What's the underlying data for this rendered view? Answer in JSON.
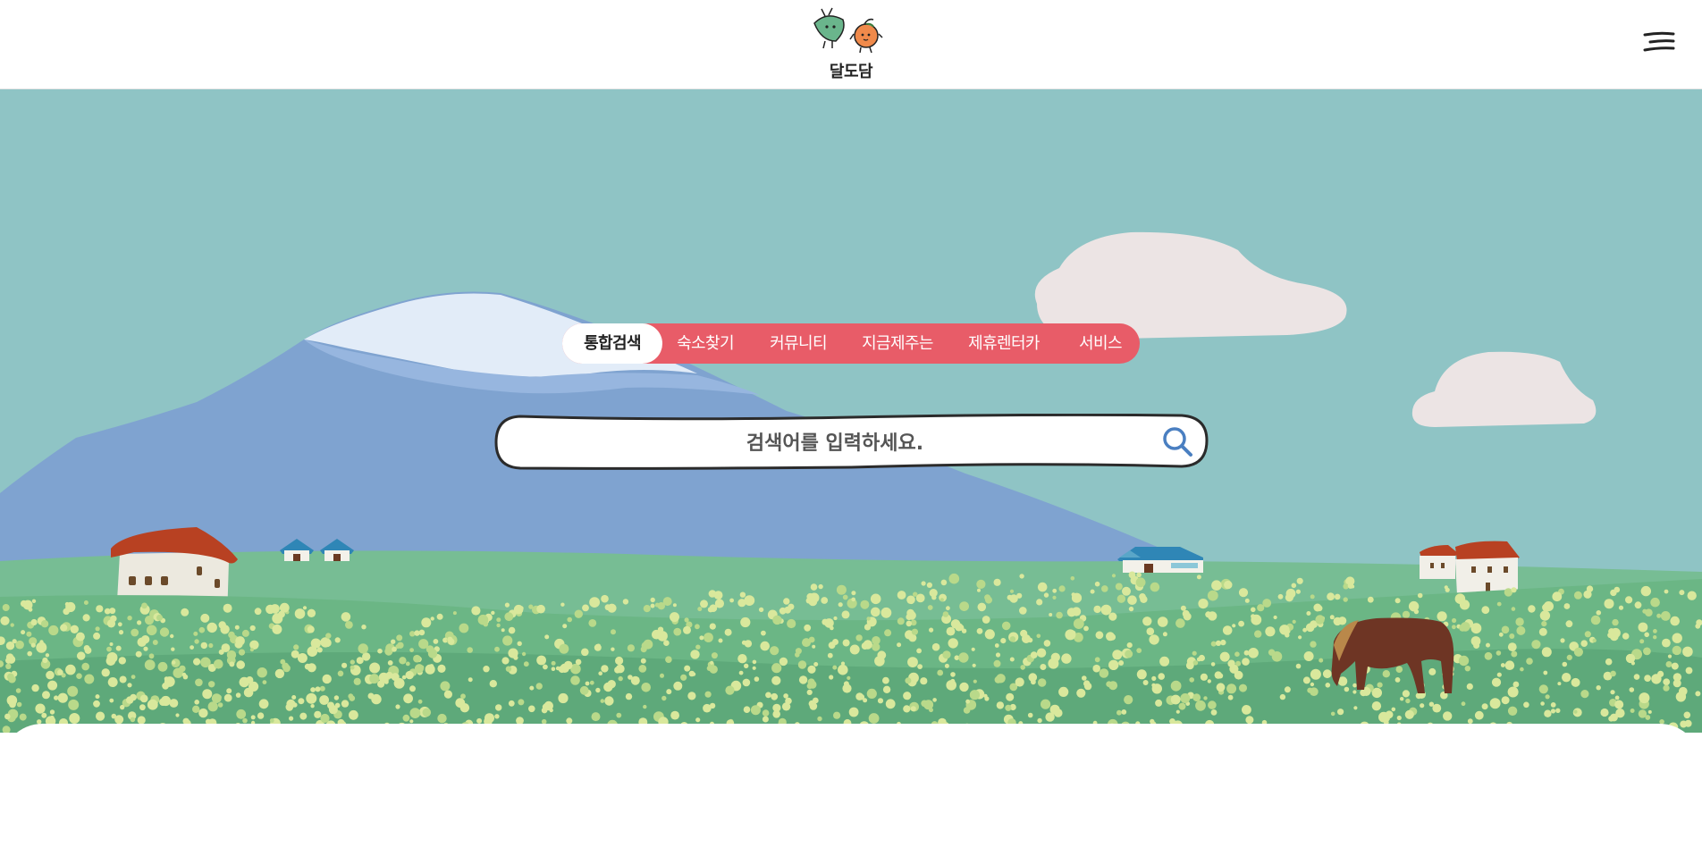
{
  "header": {
    "logo_text": "달도담",
    "menu_icon": "hamburger-menu-icon"
  },
  "tabs": [
    {
      "label": "통합검색",
      "active": true
    },
    {
      "label": "숙소찾기",
      "active": false
    },
    {
      "label": "커뮤니티",
      "active": false
    },
    {
      "label": "지금제주는",
      "active": false
    },
    {
      "label": "제휴렌터카",
      "active": false
    },
    {
      "label": "서비스",
      "active": false
    }
  ],
  "search": {
    "placeholder": "검색어를 입력하세요.",
    "value": "",
    "icon": "search-icon"
  },
  "colors": {
    "sky": "#8fc4c5",
    "tab_bar": "#e85c68",
    "mountain": "#7fa3d0",
    "snow": "#e2ecf8",
    "field": "#6bb685",
    "roof": "#b84122",
    "cloud": "#ece4e4",
    "search_icon": "#4a7fc1"
  }
}
